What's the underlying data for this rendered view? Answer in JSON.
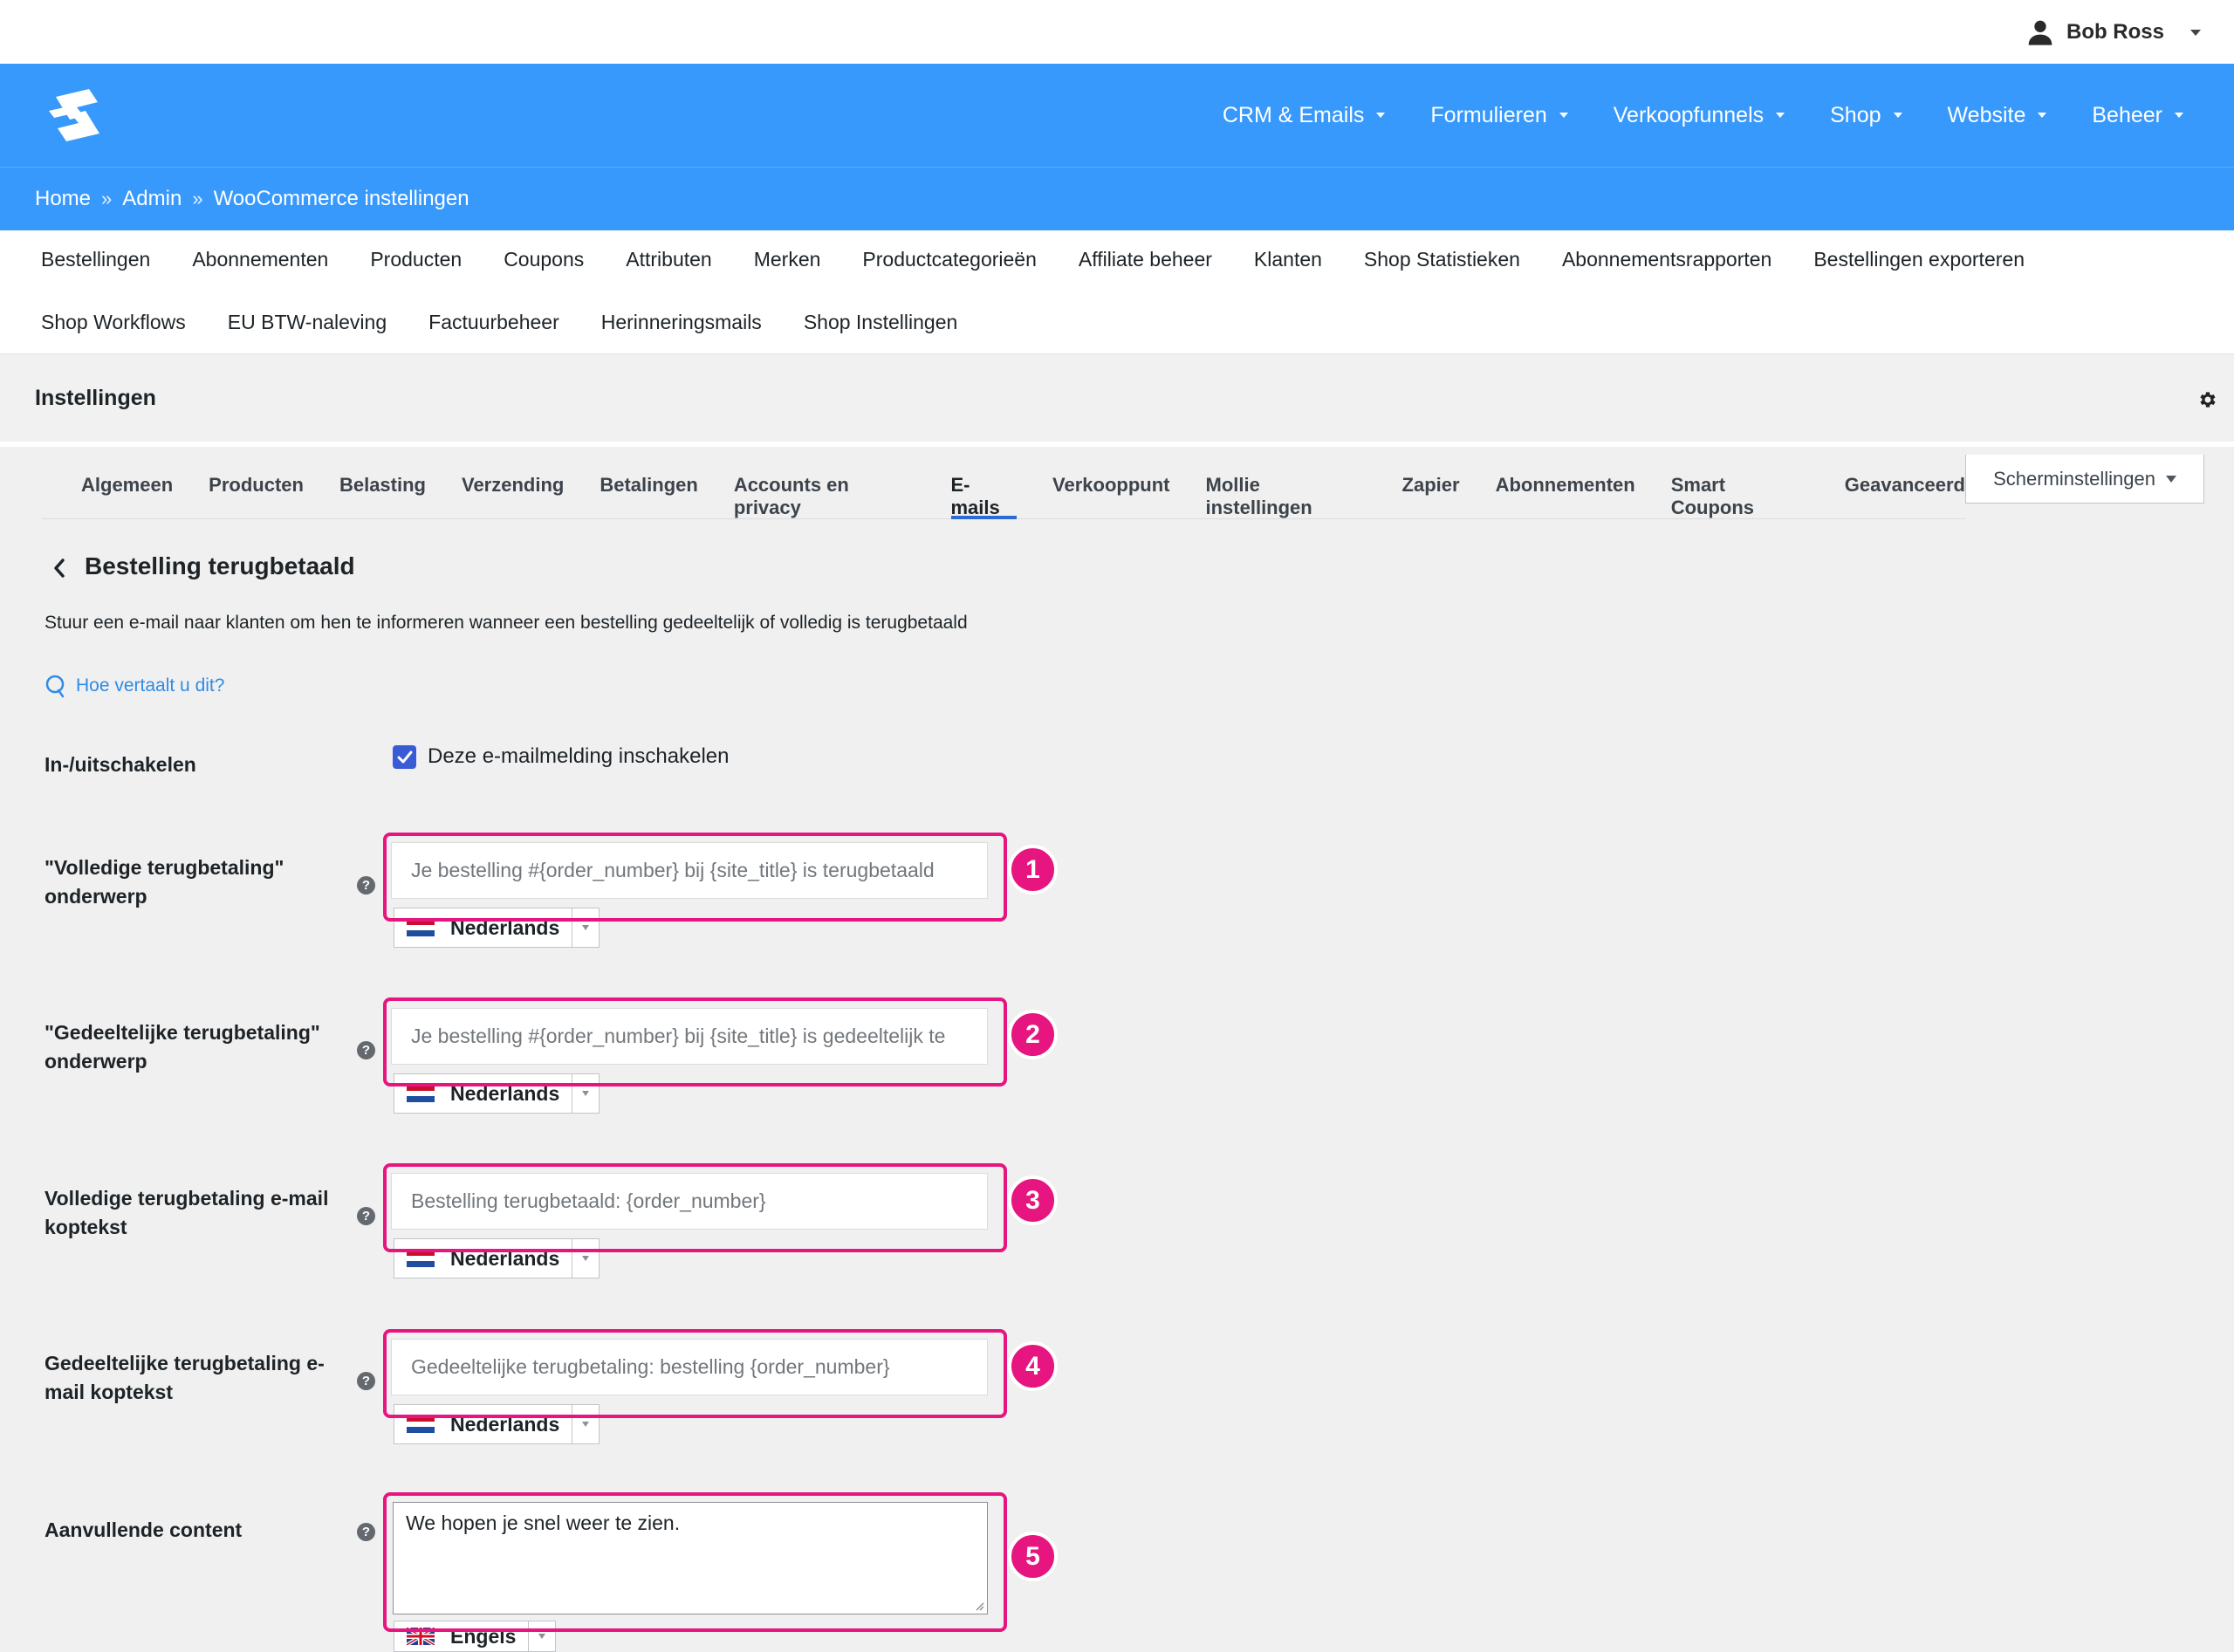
{
  "user": {
    "name": "Bob Ross",
    "icon": "user-icon"
  },
  "main_nav": [
    "CRM & Emails",
    "Formulieren",
    "Verkoopfunnels",
    "Shop",
    "Website",
    "Beheer"
  ],
  "breadcrumb": [
    "Home",
    "Admin",
    "WooCommerce instellingen"
  ],
  "breadcrumb_separator": "»",
  "sub_nav": {
    "row1": [
      "Bestellingen",
      "Abonnementen",
      "Producten",
      "Coupons",
      "Attributen",
      "Merken",
      "Productcategorieën",
      "Affiliate beheer",
      "Klanten",
      "Shop Statistieken",
      "Abonnementsrapporten",
      "Bestellingen exporteren"
    ],
    "row2": [
      "Shop Workflows",
      "EU BTW-naleving",
      "Factuurbeheer",
      "Herinneringsmails",
      "Shop Instellingen"
    ]
  },
  "page_title": "Instellingen",
  "screen_options": "Scherminstellingen",
  "tabs": [
    "Algemeen",
    "Producten",
    "Belasting",
    "Verzending",
    "Betalingen",
    "Accounts en privacy",
    "E-mails",
    "Verkooppunt",
    "Mollie instellingen",
    "Zapier",
    "Abonnementen",
    "Smart Coupons",
    "Geavanceerd"
  ],
  "active_tab": "E-mails",
  "section": {
    "title": "Bestelling terugbetaald",
    "description": "Stuur een e-mail naar klanten om hen te informeren wanneer een bestelling gedeeltelijk of volledig is terugbetaald",
    "help_link": "Hoe vertaalt u dit?"
  },
  "fields": {
    "enable": {
      "label": "In-/uitschakelen",
      "checkbox_label": "Deze e-mailmelding inschakelen",
      "checked": true
    },
    "full_subject": {
      "label": "\"Volledige terugbetaling\" onderwerp",
      "placeholder": "Je bestelling #{order_number} bij {site_title} is terugbetaald",
      "language": "Nederlands",
      "badge": "1"
    },
    "partial_subject": {
      "label": "\"Gedeeltelijke terugbetaling\" onderwerp",
      "placeholder": "Je bestelling #{order_number} bij {site_title} is gedeeltelijk te",
      "language": "Nederlands",
      "badge": "2"
    },
    "full_heading": {
      "label": "Volledige terugbetaling e-mail koptekst",
      "placeholder": "Bestelling terugbetaald: {order_number}",
      "language": "Nederlands",
      "badge": "3"
    },
    "partial_heading": {
      "label": "Gedeeltelijke terugbetaling e-mail koptekst",
      "placeholder": "Gedeeltelijke terugbetaling: bestelling {order_number}",
      "language": "Nederlands",
      "badge": "4"
    },
    "additional": {
      "label": "Aanvullende content",
      "value": "We hopen je snel weer te zien.",
      "language": "Engels",
      "badge": "5"
    }
  },
  "help_icon_glyph": "?",
  "colors": {
    "brand_blue": "#3899fd",
    "highlight": "#e6157f",
    "checkbox": "#3a5bd6",
    "link": "#2f8be6"
  }
}
